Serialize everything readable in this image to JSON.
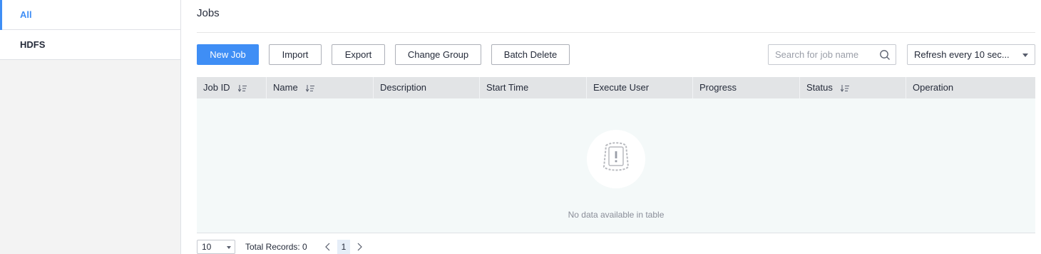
{
  "sidebar": {
    "items": [
      {
        "label": "All",
        "active": true
      },
      {
        "label": "HDFS",
        "active": false
      }
    ]
  },
  "page": {
    "title": "Jobs"
  },
  "toolbar": {
    "new_job": "New Job",
    "import": "Import",
    "export": "Export",
    "change_group": "Change Group",
    "batch_delete": "Batch Delete",
    "search_placeholder": "Search for job name",
    "refresh_select": "Refresh every 10 sec..."
  },
  "table": {
    "columns": [
      {
        "label": "Job ID",
        "sortable": true
      },
      {
        "label": "Name",
        "sortable": true
      },
      {
        "label": "Description",
        "sortable": false
      },
      {
        "label": "Start Time",
        "sortable": false
      },
      {
        "label": "Execute User",
        "sortable": false
      },
      {
        "label": "Progress",
        "sortable": false
      },
      {
        "label": "Status",
        "sortable": true
      },
      {
        "label": "Operation",
        "sortable": false
      }
    ],
    "rows": [],
    "empty_text": "No data available in table"
  },
  "pagination": {
    "page_size": "10",
    "total_label": "Total Records: 0",
    "current_page": "1"
  },
  "colors": {
    "accent": "#3f8ef5",
    "header_bg": "#e2e4e6",
    "empty_bg": "#f4f9f9"
  }
}
